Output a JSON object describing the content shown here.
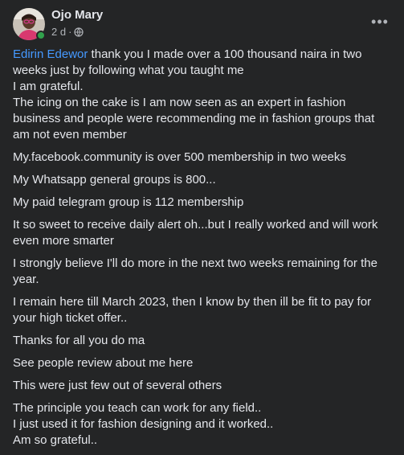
{
  "post": {
    "author": "Ojo Mary",
    "time": "2 d",
    "separator": "·",
    "more_label": "•••",
    "mention": "Edirin Edewor",
    "paragraphs": {
      "p1": {
        "l1_rest": " thank you I made over a 100 thousand naira in two",
        "l2": "weeks just by following what you taught me",
        "l3": "I am grateful.",
        "l4": "The icing on the cake is I am now seen as an expert in fashion",
        "l5": "business and people were recommending me in fashion groups that",
        "l6": "am not even member"
      },
      "p2": "My.facebook.community is over 500 membership in two weeks",
      "p3": "My Whatsapp general groups is 800...",
      "p4": "My paid telegram group is 112 membership",
      "p5": {
        "l1": "It so sweet to receive daily alert oh...but I really worked and will work",
        "l2": "even more smarter"
      },
      "p6": {
        "l1": "I strongly believe I'll do more in the next two weeks remaining for the",
        "l2": "year."
      },
      "p7": {
        "l1": "I remain here till March 2023, then I know by then ill be fit to pay for",
        "l2": "your high ticket offer.."
      },
      "p8": "Thanks for all you do ma",
      "p9": "See people review about me here",
      "p10": "This were just few out of several others",
      "p11": {
        "l1": "The principle you teach can work for any field..",
        "l2": "I just used it for fashion designing and it worked..",
        "l3": "Am so grateful.."
      }
    }
  }
}
